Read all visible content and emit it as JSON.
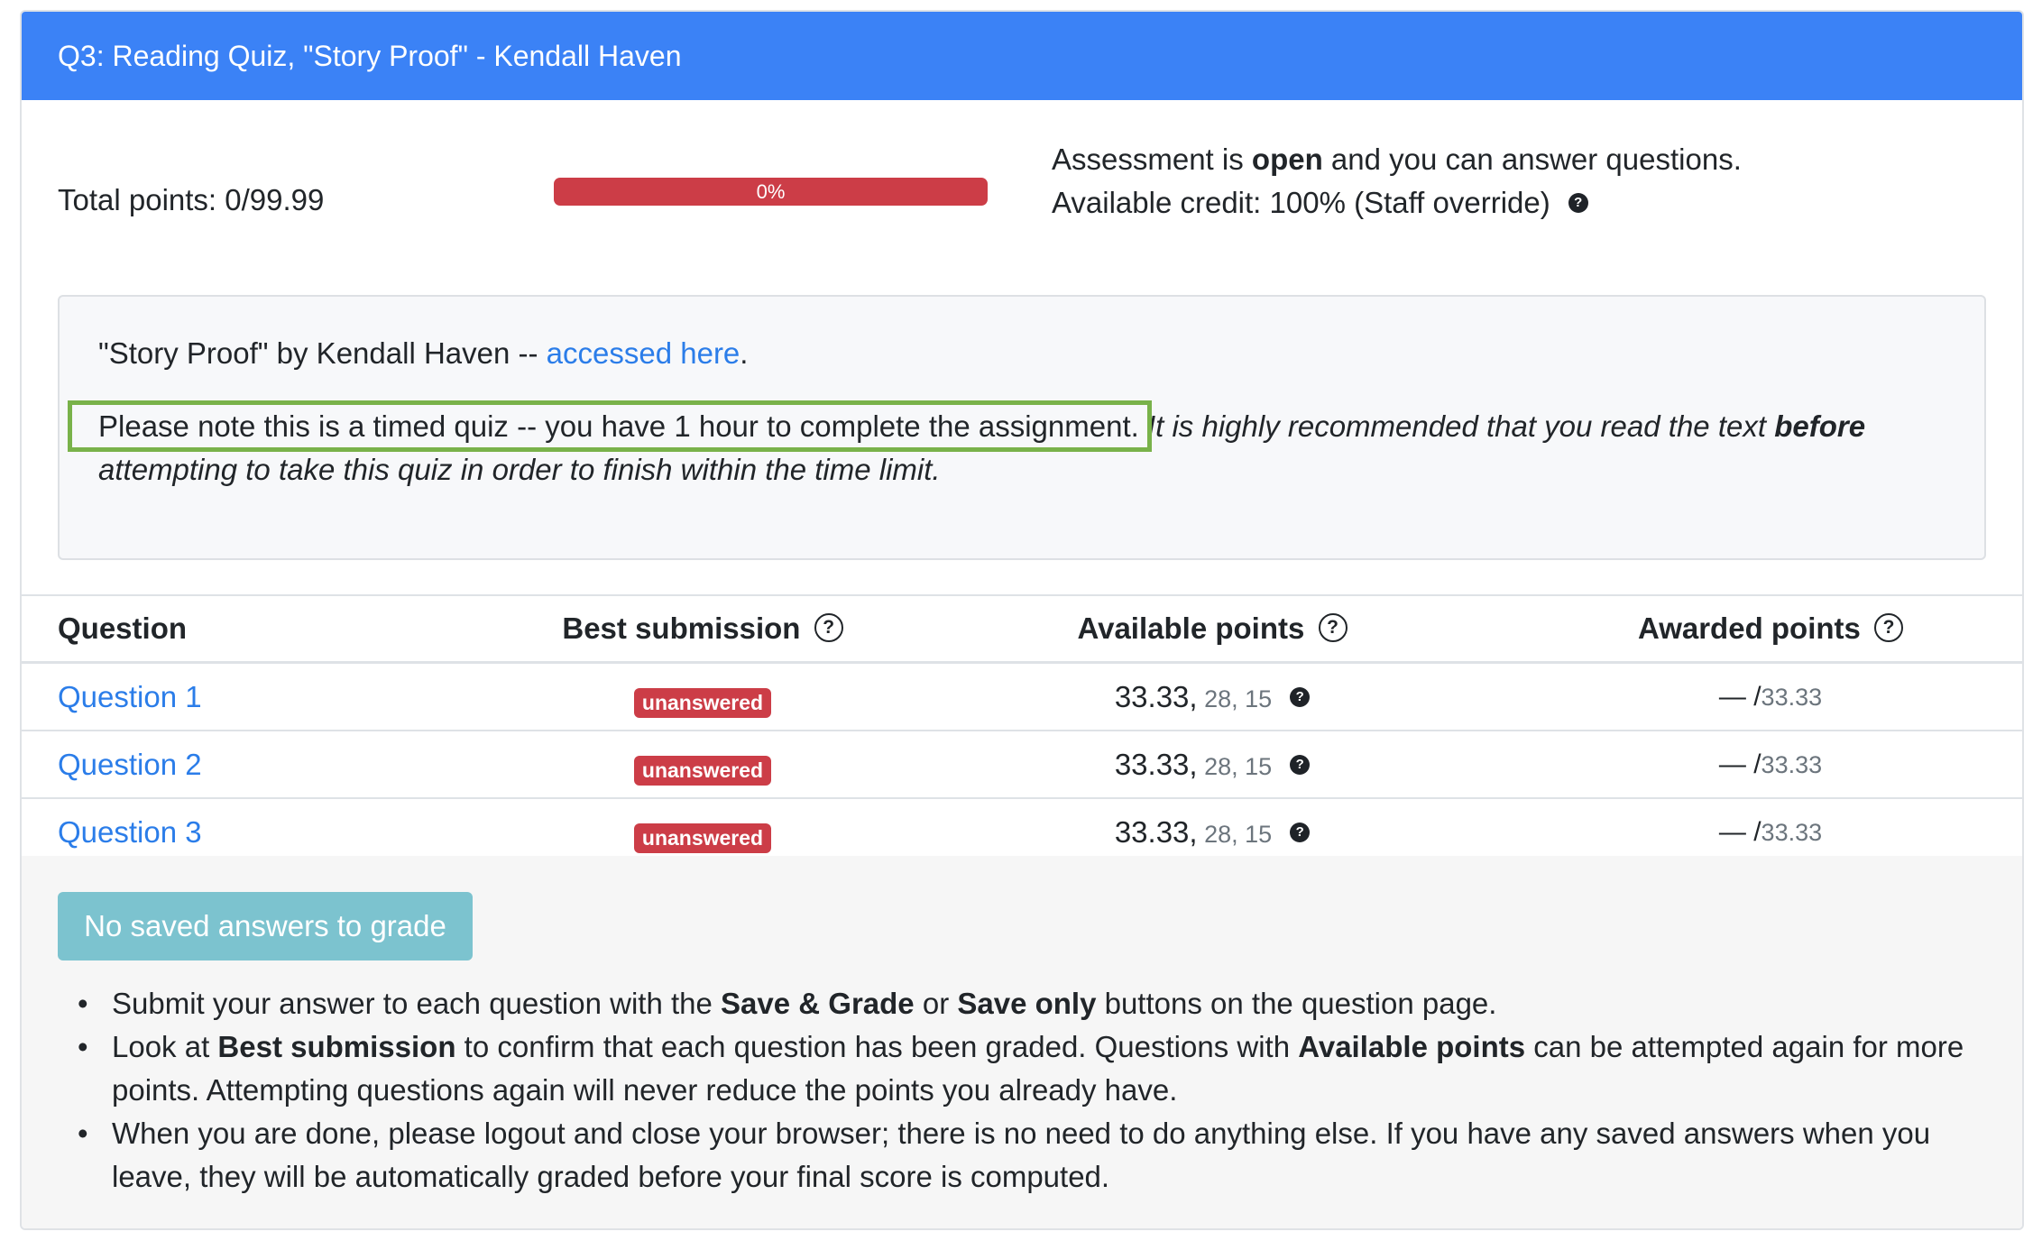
{
  "header": {
    "title": "Q3: Reading Quiz, \"Story Proof\" - Kendall Haven"
  },
  "summary": {
    "total_points": "Total points: 0/99.99",
    "progress_label": "0%",
    "progress_fraction": 0,
    "status_pre": "Assessment is ",
    "status_bold": "open",
    "status_post": " and you can answer questions.",
    "credit": "Available credit: 100% (Staff override)",
    "help_glyph": "?"
  },
  "info": {
    "line1_text": "\"Story Proof\" by Kendall Haven -- ",
    "line1_link": "accessed here",
    "line1_end": ".",
    "timed_note": "Please note this is a timed quiz -- you have 1 hour to complete the assignment.",
    "recommend_pre": " It is highly recommended that you read the text ",
    "recommend_bold": "before",
    "recommend_post": " attempting to take this quiz in order to finish within the time limit."
  },
  "table": {
    "headers": [
      "Question",
      "Best submission",
      "Available points",
      "Awarded points"
    ],
    "rows": [
      {
        "question": "Question 1",
        "status": "unanswered",
        "points": "33.33,",
        "extra": " 28, 15",
        "awarded": "— /",
        "max": "33.33"
      },
      {
        "question": "Question 2",
        "status": "unanswered",
        "points": "33.33,",
        "extra": " 28, 15",
        "awarded": "— /",
        "max": "33.33"
      },
      {
        "question": "Question 3",
        "status": "unanswered",
        "points": "33.33,",
        "extra": " 28, 15",
        "awarded": "— /",
        "max": "33.33"
      }
    ]
  },
  "footer": {
    "grade_button": "No saved answers to grade",
    "tips": [
      {
        "a": "Submit your answer to each question with the ",
        "b": "Save & Grade",
        "c": " or ",
        "d": "Save only",
        "e": " buttons on the question page."
      },
      {
        "a": "Look at ",
        "b": "Best submission",
        "c": " to confirm that each question has been graded. Questions with ",
        "d": "Available points",
        "e": " can be attempted again for more points. Attempting questions again will never reduce the points you already have."
      },
      {
        "a": "When you are done, please logout and close your browser; there is no need to do anything else. If you have any saved answers when you leave, they will be automatically graded before your final score is computed.",
        "b": "",
        "c": "",
        "d": "",
        "e": ""
      }
    ]
  },
  "colors": {
    "header_bg": "#3b82f6",
    "danger": "#cc3d47",
    "link": "#2b7de9",
    "highlight_box": "#79b24a",
    "disabled_button": "#7cc3cf"
  }
}
